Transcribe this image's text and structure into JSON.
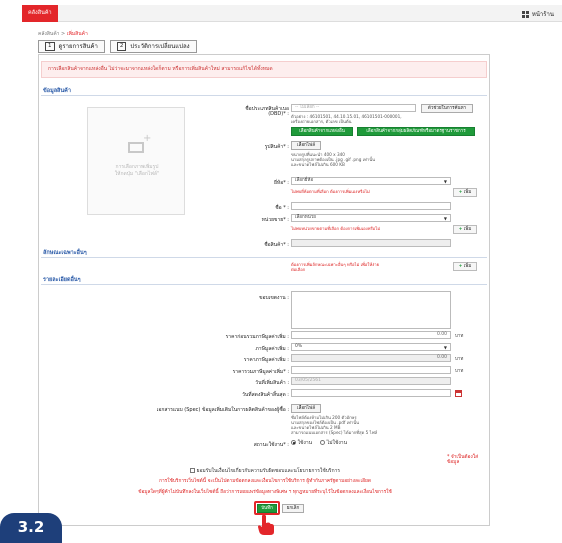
{
  "topbar": {
    "brand": "คลังสินค้า",
    "home": "หน้าร้าน"
  },
  "breadcrumb": {
    "root": "คลังสินค้า >",
    "current": "เพิ่มสินค้า"
  },
  "tabs": [
    {
      "num": "1",
      "label": "ดูรายการสินค้า"
    },
    {
      "num": "2",
      "label": "ประวัติการเปลี่ยนแปลง"
    }
  ],
  "notice": "การเลือกสินค้าจากแหล่งอื่น ไม่ว่าจะมาจากแหล่งใดก็ตาม หรือการเพิ่มสินค้าใหม่ สามารถแก้ไขได้ทั้งหมด",
  "sections": {
    "product": "ข้อมูลสินค้า",
    "features": "ลักษณะเฉพาะอื่นๆ",
    "details": "รายละเอียดอื่นๆ"
  },
  "image_box": {
    "caption_1": "การเลือกภาพเพิ่มรูป",
    "caption_2": "ให้กดปุ่ม \"เลือกไฟล์\""
  },
  "form": {
    "type_label": "ชื่อประเภทสินค้าเบอ",
    "type_label_2": "(DBD)* :",
    "type_placeholder": "-- ไม่เลือก --",
    "type_hint_1": "ตัวอย่าง : 46101501, 44.10.15.01, 46101501-000001,",
    "type_hint_2": "เครื่องถ่ายเอกสาร, ตัวเลข เป็นต้น",
    "type_view_btn": "ตัวช่วยในการค้นหา",
    "btn_select_other": "เลือกสินค้าจากแหล่งอื่น",
    "btn_select_std": "เลือกสินค้าจากกลุ่มผลิตภัณฑ์หรือมาตรฐานราชการ",
    "image_label": "รูปสินค้า* :",
    "choose_file": "เลือกไฟล์",
    "image_hint_1": "ขนาดรูปที่แนะนำ 400 x 340",
    "image_hint_2": "นามสกุลรูปภาพต้องเป็น .jpg .gif .png เท่านั้น",
    "image_hint_3": "และขนาดไฟล์ไม่เกิน 600 KB",
    "brand_label": "ยี่ห้อ* :",
    "brand_select": "เลือกยี่ห้อ",
    "brand_err": "ไม่พบยี่ห้อตามที่เลือก ต้องการเพิ่มเองหรือไม่",
    "add_label": "เพิ่ม",
    "name_label": "ชื่อ * :",
    "unit_label": "หน่วยขาย* :",
    "unit_select": "เลือกหน่วย",
    "unit_err": "ไม่พบหน่วยขายตามที่เลือก ต้องการเพิ่มเองหรือไม่",
    "product_name_label": "ชื่อสินค้า* :",
    "feature_err_1": "ต้องการเพิ่มลักษณะเฉพาะอื่นๆ หรือไม่ เพื่อให้ง่าย",
    "feature_err_2": "ต่อเลือก",
    "detail_label": "ขอบเขตงาน :",
    "price_label": "ราคาก่อนรวมภาษีมูลค่าเพิ่ม :",
    "price_value": "0.00",
    "currency": "บาท",
    "vat_label": "ภาษีมูลค่าเพิ่ม :",
    "vat_value": "0%",
    "vat_amount_label": "ราคาภาษีมูลค่าเพิ่ม :",
    "vat_amount_value": "0.00",
    "total_label": "ราคารวมภาษีมูลค่าเพิ่ม* :",
    "date_added_label": "วันที่เพิ่มสินค้า :",
    "date_added_value": "03/05/2561",
    "expire_label": "วันที่สดงสินค้าสิ้นสุด :",
    "spec_label": "เอกสารแนบ (Spec) ข้อมูลเพิ่มเติมในการผลิตสินค้าของผู้ซื้อ :",
    "spec_hint_1": "ชื่อไฟล์ต้องห้ามไม่เกิน 200 ตัวอักษร",
    "spec_hint_2": "นามสกุลของไฟล์ต้องเป็น .pdf เท่านั้น",
    "spec_hint_3": "และขนาดไฟล์ไม่เกิน 2 MB",
    "spec_hint_4": "สามารถแนบเอกสาร (Spec) ได้มากที่สุด 5 ไฟล์",
    "status_label": "สถานะใช้งาน* :",
    "status_on": "ใช้งาน",
    "status_off": "ไม่ใช้งาน",
    "required_note": "* จำเป็นต้องใส่ข้อมูล"
  },
  "consent": {
    "check_text": "ยอมรับในเงื่อนไขเกี่ยวกับความรับผิดชอบและนโยบายการใช้บริการ",
    "line_1": "การใช้บริการเว็บไซต์นี้ จะเป็นไปตามข้อตกลงและเงื่อนไขการใช้บริการ ผู้ทำกับภาครัฐตามอย่างละเอียด",
    "line_2": "ข้อมูลใดๆที่ผู้ค้าไม่บันทึกลงในเว็บไซต์นี้ ถือว่าการเผยแพร่ข้อมูลทางพิเศษ ฯ ทุกฎหมายที่ระบุไว้ในข้อตกลงและเงื่อนไขการใช้"
  },
  "actions": {
    "save": "บันทึก",
    "cancel": "ยกเลิก"
  },
  "step_badge": "3.2",
  "colors": {
    "brand_red": "#e3262a",
    "green": "#1f9a3a",
    "link_blue": "#2a5aa8",
    "badge_navy": "#1e3f7a"
  }
}
